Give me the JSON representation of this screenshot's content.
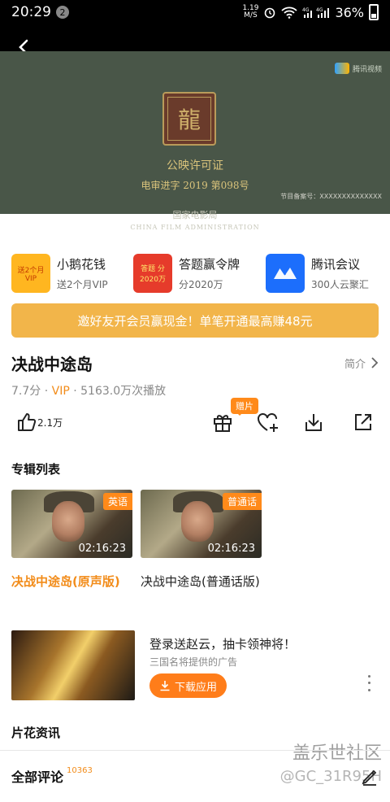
{
  "status_bar": {
    "time": "20:29",
    "notif_count": "2",
    "speed_value": "1.19",
    "speed_unit": "M/S",
    "battery": "36%"
  },
  "video": {
    "license_title": "公映许可证",
    "license_number": "电审进字 2019 第098号",
    "issuer_cn": "国家电影局",
    "issuer_en": "CHINA FILM ADMINISTRATION",
    "seal_char": "龍",
    "watermark": "腾讯视频",
    "record_code": "节目备案号：XXXXXXXXXXXXXX"
  },
  "promos": [
    {
      "icon_text": "送2个月 VIP",
      "title": "小鹅花钱",
      "subtitle": "送2个月VIP"
    },
    {
      "icon_text": "答题 分2020万",
      "title": "答题赢令牌",
      "subtitle": "分2020万"
    },
    {
      "icon_text": "",
      "title": "腾讯会议",
      "subtitle": "300人云聚汇"
    }
  ],
  "invite_banner": "邀好友开会员赢现金！单笔开通最高赚48元",
  "movie": {
    "title": "决战中途岛",
    "intro_label": "简介",
    "score": "7.7分",
    "vip": "VIP",
    "plays": "5163.0万次播放",
    "sep": "·"
  },
  "actions": {
    "like_count": "2.1万",
    "gift_tag": "赠片"
  },
  "album": {
    "section_title": "专辑列表",
    "episodes": [
      {
        "badge": "英语",
        "duration": "02:16:23",
        "title": "决战中途岛(原声版)"
      },
      {
        "badge": "普通话",
        "duration": "02:16:23",
        "title": "决战中途岛(普通话版)"
      }
    ]
  },
  "ad": {
    "title": "登录送赵云，抽卡领神将！",
    "subtitle": "三国名将提供的广告",
    "download_label": "下载应用"
  },
  "highlights_title": "片花资讯",
  "comments": {
    "label": "全部评论",
    "count": "10363"
  },
  "overlay_watermark": {
    "line1": "盖乐世社区",
    "line2": "@GC_31R95H"
  }
}
